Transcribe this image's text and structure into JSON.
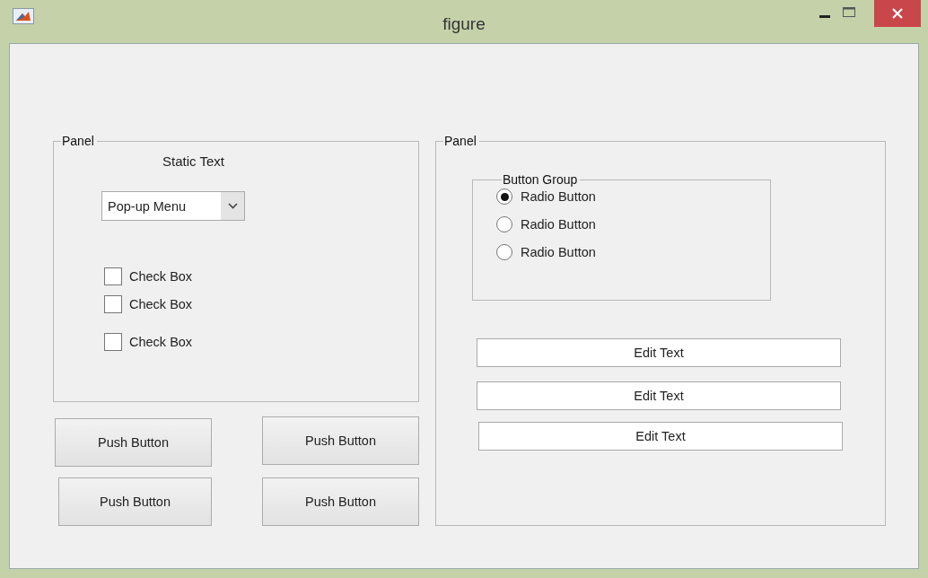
{
  "window": {
    "title": "figure"
  },
  "left_panel": {
    "title": "Panel",
    "static_text": "Static Text",
    "popup": {
      "value": "Pop-up Menu"
    },
    "checkboxes": [
      {
        "label": "Check Box",
        "checked": false
      },
      {
        "label": "Check Box",
        "checked": false
      },
      {
        "label": "Check Box",
        "checked": false
      }
    ]
  },
  "push_buttons": [
    "Push Button",
    "Push Button",
    "Push Button",
    "Push Button"
  ],
  "right_panel": {
    "title": "Panel",
    "button_group": {
      "title": "Button Group",
      "radios": [
        {
          "label": "Radio Button",
          "selected": true
        },
        {
          "label": "Radio Button",
          "selected": false
        },
        {
          "label": "Radio Button",
          "selected": false
        }
      ]
    },
    "edit_texts": [
      {
        "value": "Edit Text"
      },
      {
        "value": "Edit Text"
      },
      {
        "value": "Edit Text"
      }
    ]
  }
}
